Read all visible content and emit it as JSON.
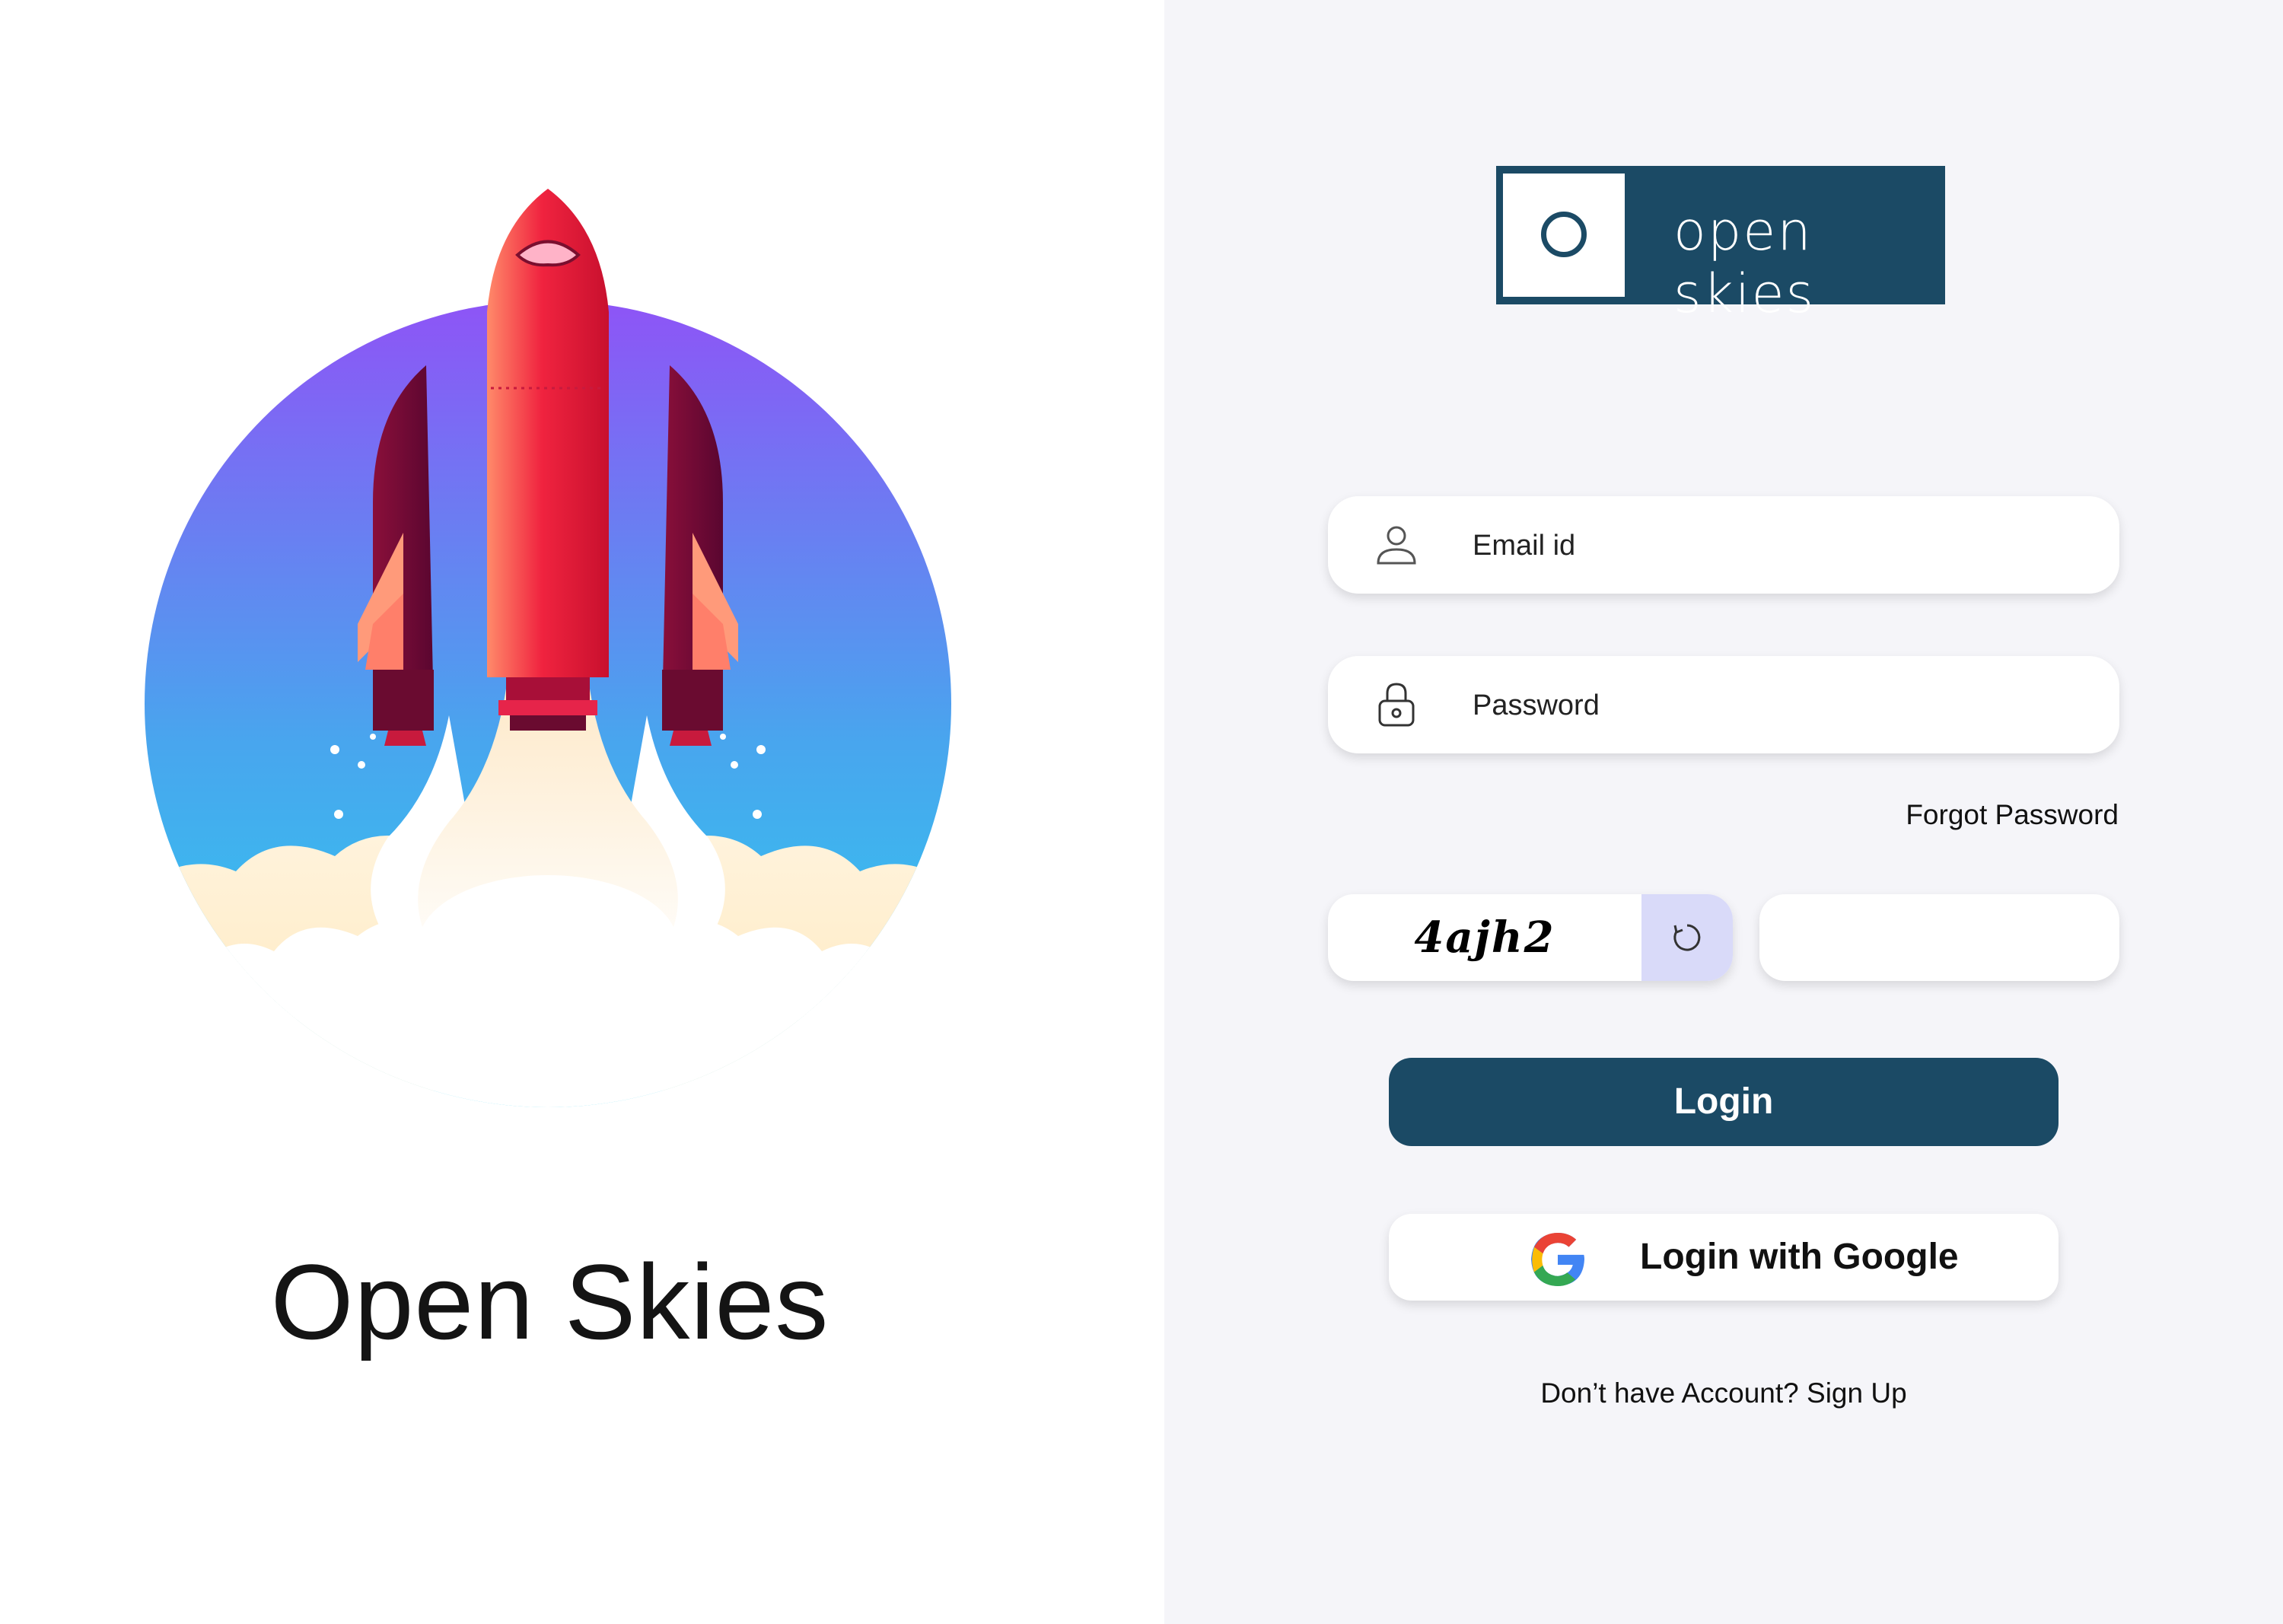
{
  "brand": {
    "title": "Open Skies",
    "logo_text": "open skies"
  },
  "form": {
    "email_placeholder": "Email id",
    "password_placeholder": "Password",
    "forgot_label": "Forgot Password",
    "captcha_code": "4ajh2",
    "captcha_input_value": "",
    "login_label": "Login",
    "google_label": "Login with Google",
    "signup_prompt": "Don’t have Account?",
    "signup_link": "Sign Up"
  },
  "icons": {
    "email": "user-icon",
    "password": "lock-icon",
    "refresh": "refresh-icon",
    "google": "google-icon",
    "illustration": "rocket-illustration"
  },
  "colors": {
    "primary": "#1b4a65",
    "panel_background": "#f5f5f9",
    "captcha_refresh_bg": "#d9daf9",
    "rocket_red": "#f0233f",
    "sky_top": "#8e54f6",
    "sky_bottom": "#2ccff0"
  }
}
